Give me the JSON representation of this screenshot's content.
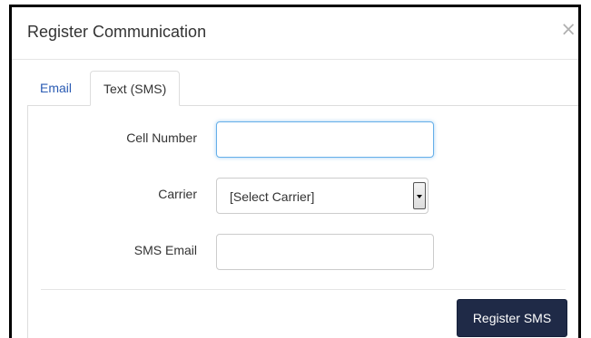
{
  "modal": {
    "title": "Register Communication",
    "close_label": "×"
  },
  "tabs": [
    {
      "label": "Email",
      "active": false
    },
    {
      "label": "Text (SMS)",
      "active": true
    }
  ],
  "form": {
    "cell_number": {
      "label": "Cell Number",
      "value": ""
    },
    "carrier": {
      "label": "Carrier",
      "selected": "[Select Carrier]"
    },
    "sms_email": {
      "label": "SMS Email",
      "value": ""
    }
  },
  "actions": {
    "register_label": "Register SMS"
  },
  "colors": {
    "accent": "#1f2a47",
    "tab_link": "#2a5bb3",
    "focus": "#66afe9"
  }
}
